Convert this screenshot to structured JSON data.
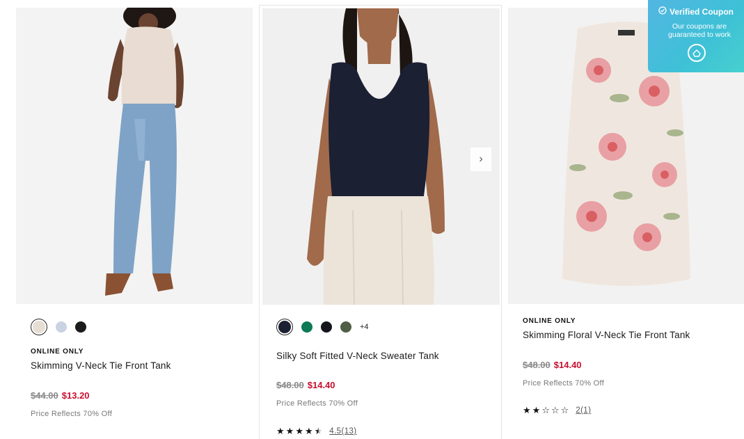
{
  "colors": {
    "sale": "#c8102e",
    "original": "#8a8a8a",
    "coupon_bg": "#4bbfe0"
  },
  "products": [
    {
      "tag": "ONLINE ONLY",
      "name": "Skimming V-Neck Tie Front Tank",
      "original_price": "$44.00",
      "sale_price": "$13.20",
      "note": "Price Reflects 70% Off",
      "swatches": [
        "#e6ddd3",
        "#c9d3e2",
        "#1b1b1b"
      ]
    },
    {
      "tag": "",
      "name": "Silky Soft Fitted V-Neck Sweater Tank",
      "original_price": "$48.00",
      "sale_price": "$14.40",
      "note": "Price Reflects 70% Off",
      "swatches": [
        "#1b2033",
        "#0b7a55",
        "#15161d",
        "#4f5e45"
      ],
      "more_colors": "+4",
      "rating": 4.5,
      "review_count": "4.5(13)"
    },
    {
      "tag": "ONLINE ONLY",
      "name": "Skimming Floral V-Neck Tie Front Tank",
      "original_price": "$48.00",
      "sale_price": "$14.40",
      "note": "Price Reflects 70% Off",
      "rating": 2,
      "review_count": "2(1)"
    }
  ],
  "coupon": {
    "title": "Verified Coupon",
    "subtitle_line1": "Our coupons are",
    "subtitle_line2": "guaranteed to work"
  }
}
